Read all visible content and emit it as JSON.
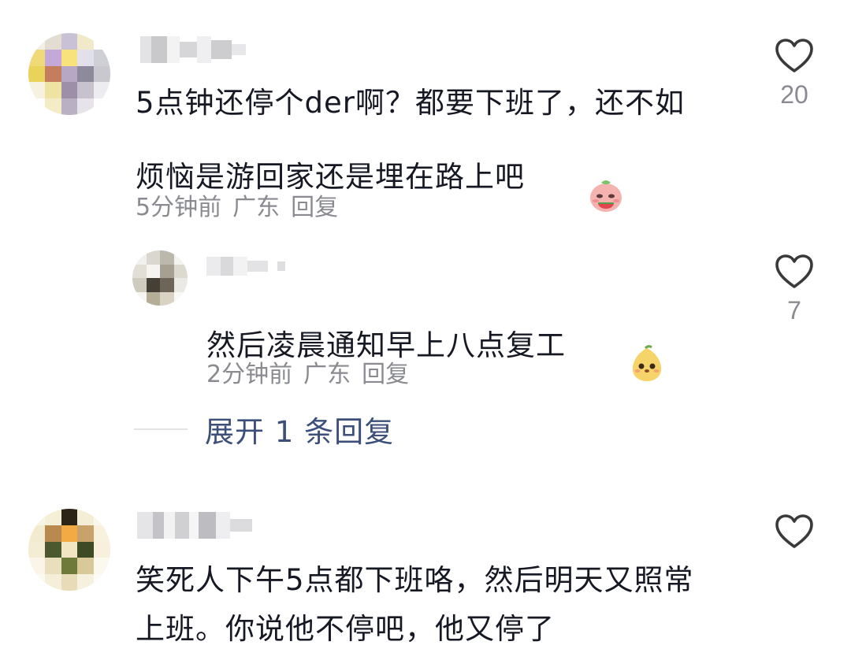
{
  "comments": [
    {
      "text": "5点钟还停个der啊？都要下班了，还不如\n烦恼是游回家还是埋在路上吧",
      "emoji_icon": "watermelon-face-icon",
      "time": "5分钟前",
      "location": "广东",
      "reply_label": "回复",
      "likes": "20"
    },
    {
      "text": "然后凌晨通知早上八点复工",
      "emoji_icon": "pear-face-icon",
      "time": "2分钟前",
      "location": "广东",
      "reply_label": "回复",
      "likes": "7"
    },
    {
      "text": "笑死人下午5点都下班咯，然后明天又照常\n上班。你说他不停吧，他又停了",
      "likes": ""
    }
  ],
  "expand_replies": {
    "label": "展开 1 条回复"
  },
  "icons": {
    "like": "heart-outline-icon"
  },
  "colors": {
    "text": "#161823",
    "meta": "#8a8b91",
    "link": "#3b4f7a",
    "heart": "#3a3a3c"
  }
}
